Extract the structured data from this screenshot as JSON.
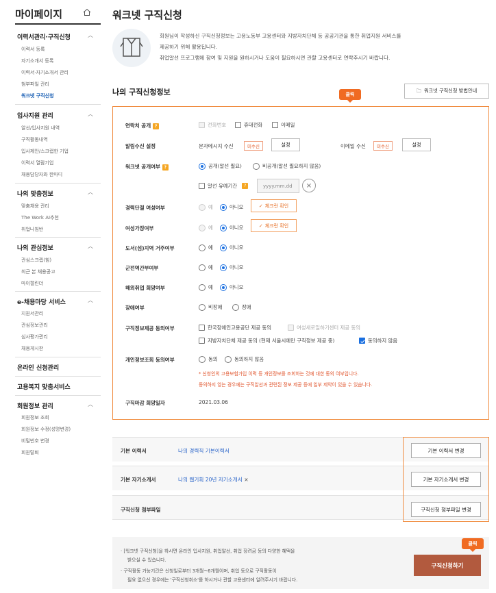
{
  "sidebar": {
    "title": "마이페이지",
    "sections": [
      {
        "label": "이력서관리·구직신청",
        "items": [
          "이력서 등록",
          "자기소개서 등록",
          "이력서·자기소개서 관리",
          "첨부파일 관리",
          "워크넷 구직신청"
        ]
      },
      {
        "label": "입사지원 관리",
        "items": [
          "알선/입사지원 내역",
          "구직활동내역",
          "입사제안/스크랩한 기업",
          "이력서 열람기업",
          "채용담당자와 한마디"
        ]
      },
      {
        "label": "나의 맞춤정보",
        "items": [
          "맞춤채용 관리",
          "The Work AI추천",
          "취업나침반"
        ]
      },
      {
        "label": "나의 관심정보",
        "items": [
          "관심스크랩(힘)",
          "최근 본 채용공고",
          "마이캘린더"
        ]
      },
      {
        "label": "e-채용마당 서비스",
        "items": [
          "지원서관리",
          "관심정보관리",
          "심사평가관리",
          "채용게시판"
        ]
      },
      {
        "label": "온라인 신청관리",
        "items": []
      },
      {
        "label": "고용복지 맞춤서비스",
        "items": []
      },
      {
        "label": "회원정보 관리",
        "items": [
          "회원정보 조회",
          "회원정보 수정(성명변경)",
          "비밀번호 변경",
          "회원탈퇴"
        ]
      }
    ]
  },
  "main": {
    "title": "워크넷 구직신청",
    "intro": [
      "회원님이 작성하신 구직신청정보는 고용노동부 고용센터와 지방자치단체 등 공공기관을 통한 취업지원 서비스를",
      "제공하기 위해 활용됩니다.",
      "취업알선 프로그램에 참여 및 지원을 원하시거나 도움이 필요하시면 관할 고용센터로 연락주시기 바랍니다."
    ],
    "section_title": "나의 구직신청정보",
    "guide_button": "워크넷 구직신청 방법안내",
    "click_badge": "클릭",
    "q_mark": "?",
    "form": {
      "contact": {
        "label": "연락처 공개",
        "options": [
          "전화번호",
          "휴대전화",
          "이메일"
        ]
      },
      "notify": {
        "label": "알림수신 설정",
        "sms_label": "문자메시지 수신",
        "sms_status": "미수신",
        "email_label": "이메일 수신",
        "email_status": "미수신",
        "set_label": "설정"
      },
      "public": {
        "label": "워크넷 공개여부",
        "opt_public": "공개(알선 필요)",
        "opt_private": "비공개(알선 필요하지 않음)",
        "defer_label": "알선 유예기간",
        "date_placeholder": "yyyy.mm.dd",
        "clear": "×"
      },
      "career_break": {
        "label": "경력단절 여성여부",
        "yes": "예",
        "no": "아니오",
        "check": "체크란 확인"
      },
      "female_head": {
        "label": "여성가장여부",
        "yes": "예",
        "no": "아니오",
        "check": "체크란 확인"
      },
      "island": {
        "label": "도서(섬)지역 거주여부",
        "yes": "예",
        "no": "아니오"
      },
      "military": {
        "label": "군전역간부여부",
        "yes": "예",
        "no": "아니오"
      },
      "overseas": {
        "label": "해외취업 희망여부",
        "yes": "예",
        "no": "아니오"
      },
      "disability": {
        "label": "장애여부",
        "no_dis": "비장애",
        "dis": "장애"
      },
      "consent": {
        "label": "구직정보제공 동의여부",
        "opt1": "한국장애인고용공단 제공 동의",
        "opt2": "여성새로일하기센터 제공 동의",
        "opt3": "지방자치단체 제공 동의 (현재 서울시에만 구직정보 제공 중)",
        "opt4": "동의하지 않음"
      },
      "privacy": {
        "label": "개인정보조회 동의여부",
        "agree": "동의",
        "disagree": "동의하지 않음",
        "note1": "* 신청인의 고용보험가입 이력 등 개인정보를 조회하는 것에 대한 동의 여부입니다.",
        "note2": "동의하지 않는 경우에는 구직알선과 관련된 정보 제공 등에 일부 제약이 있을 수 있습니다."
      },
      "deadline": {
        "label": "구직마감 희망일자",
        "value": "2021.03.06"
      }
    },
    "docs": [
      {
        "label": "기본 이력서",
        "link": "나의 경력직 기본이력서",
        "button": "기본 이력서 변경"
      },
      {
        "label": "기본 자기소개서",
        "link": "나의 웹기획 20년 자기소개서",
        "button": "기본 자기소개서 변경"
      },
      {
        "label": "구직신청 첨부파일",
        "link": "",
        "button": "구직신청 첨부파일 변경"
      }
    ],
    "info": [
      "· [워크넷 구직신청]을 하시면 온라인 입사지원, 취업알선, 취업 장려금 등의 다양한 혜택을",
      "받으실 수 있습니다.",
      "· 구직활동 가능기간은 신청일로부터 3개월~6개월이며, 취업 등으로 구직활동이",
      "필요 없으신 경우에는 '구직신청취소'를 하시거나 관할 고용센터에 알려주시기 바랍니다."
    ],
    "apply_button": "구직신청하기"
  }
}
